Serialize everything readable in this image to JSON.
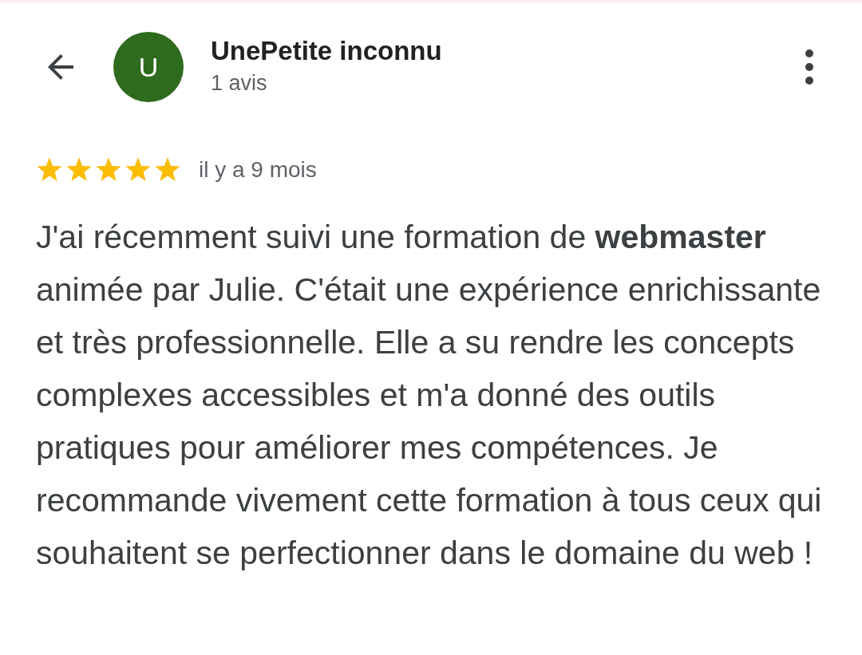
{
  "header": {
    "avatar_letter": "U",
    "name": "UnePetite inconnu",
    "subtitle": "1 avis"
  },
  "review": {
    "stars": 5,
    "time": "il y a 9 mois",
    "text": "J'ai récemment suivi une formation de **webmaster** animée par Julie. C'était une expérience enrichissante et très professionnelle. Elle a su rendre les concepts complexes accessibles et m'a donné des outils pratiques pour améliorer mes compétences. Je recommande vivement cette formation à tous ceux qui souhaitent se perfectionner dans le domaine du web !"
  }
}
